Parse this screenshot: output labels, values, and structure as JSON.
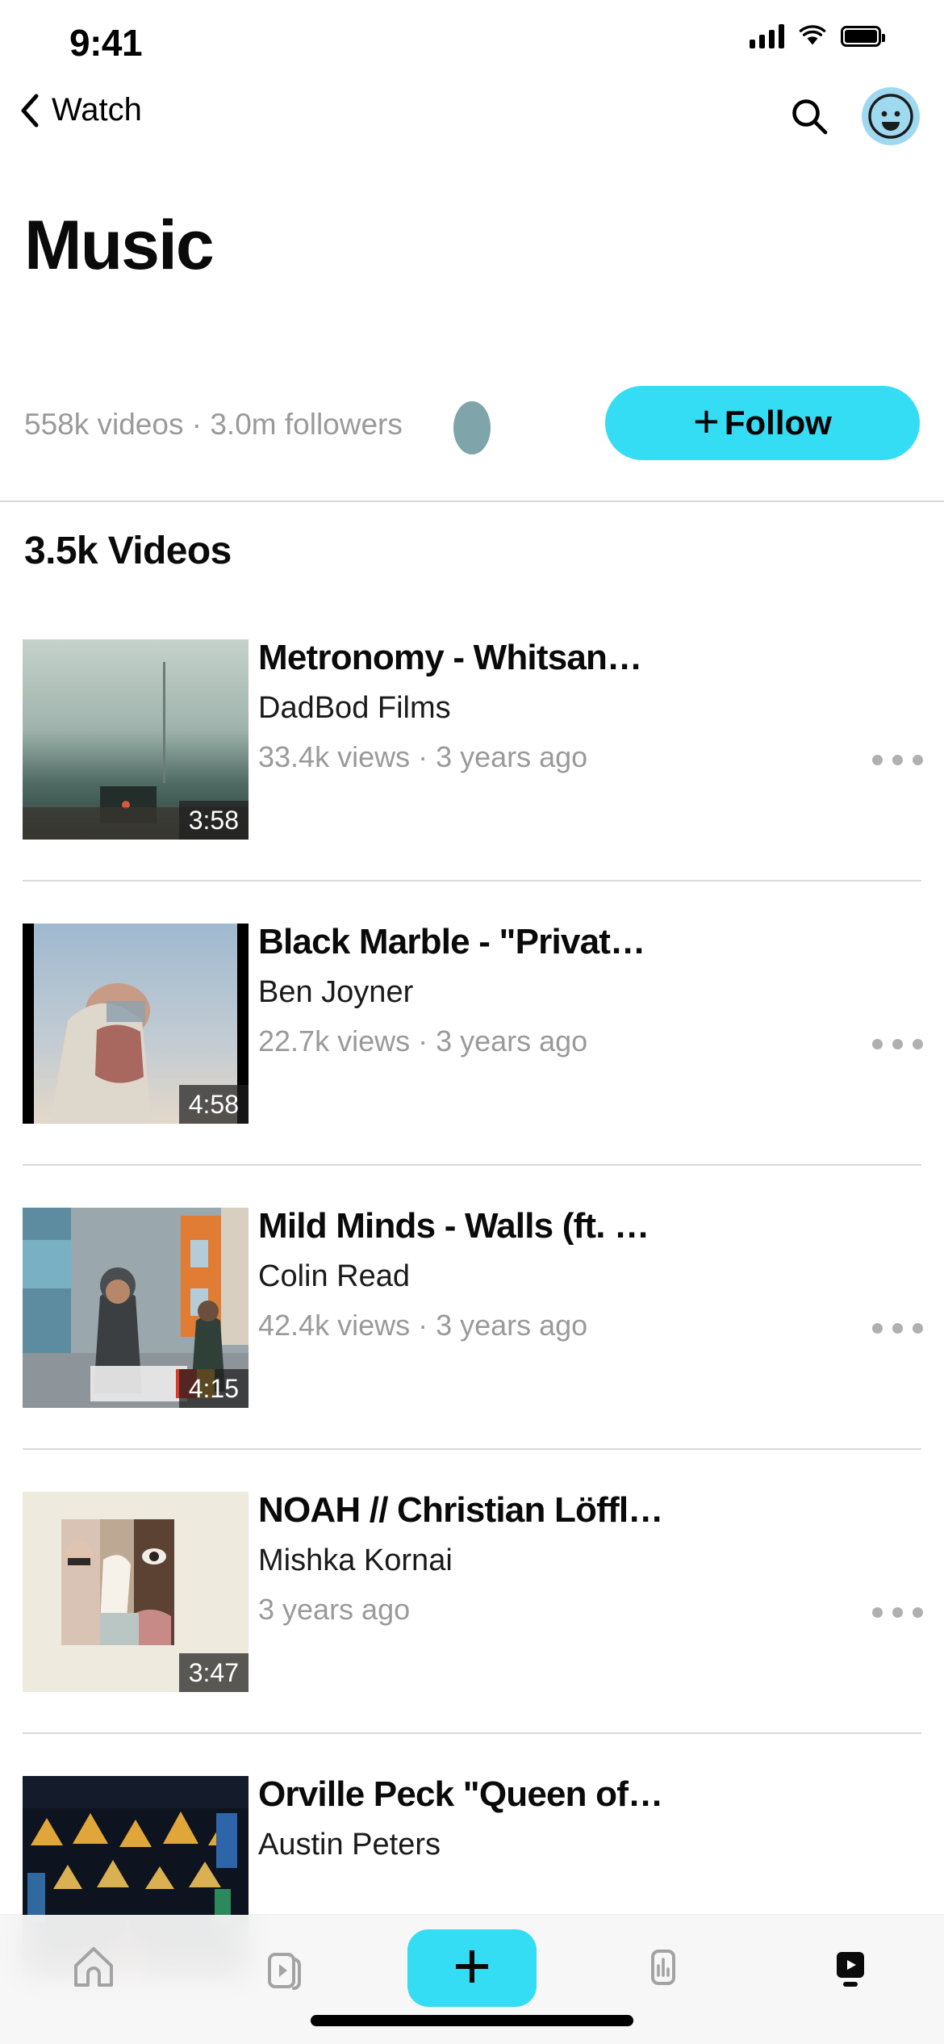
{
  "status_bar": {
    "time": "9:41",
    "cellular_icon": "signal-bars-icon",
    "wifi_icon": "wifi-icon",
    "battery_icon": "battery-full-icon"
  },
  "nav": {
    "back_icon": "chevron-left-icon",
    "back_label": "Watch",
    "search_icon": "search-icon",
    "avatar_icon": "smiley-avatar-icon"
  },
  "header": {
    "title": "Music",
    "stats": "558k videos · 3.0m followers",
    "follow_plus": "+",
    "follow_label": "Follow",
    "follow_bg_color": "#34dcf4"
  },
  "section": {
    "heading": "3.5k Videos"
  },
  "videos": [
    {
      "title": "Metronomy - Whitsan…",
      "author": "DadBod Films",
      "stats": "33.4k views · 3 years ago",
      "duration": "3:58",
      "menu_icon": "more-options-icon",
      "thumb": "foggy-field-shed"
    },
    {
      "title": "Black Marble - \"Privat…",
      "author": "Ben Joyner",
      "stats": "22.7k views · 3 years ago",
      "duration": "4:58",
      "menu_icon": "more-options-icon",
      "thumb": "man-sky-portrait"
    },
    {
      "title": "Mild Minds - Walls (ft. …",
      "author": "Colin Read",
      "stats": "42.4k views · 3 years ago",
      "duration": "4:15",
      "menu_icon": "more-options-icon",
      "thumb": "street-winter-laurels"
    },
    {
      "title": "NOAH // Christian Löffl…",
      "author": "Mishka Kornai",
      "stats": "3 years ago",
      "duration": "3:47",
      "menu_icon": "more-options-icon",
      "thumb": "collage-faces-cream"
    },
    {
      "title": "Orville Peck \"Queen of…",
      "author": "Austin Peters",
      "stats": "",
      "duration": "",
      "menu_icon": "more-options-icon",
      "thumb": "neon-bar-lamps"
    }
  ],
  "tabbar": {
    "items": [
      {
        "icon": "home-icon",
        "active": false
      },
      {
        "icon": "video-library-icon",
        "active": false
      },
      {
        "icon": "create-plus-icon",
        "active": false
      },
      {
        "icon": "stats-bars-icon",
        "active": false
      },
      {
        "icon": "watch-tv-icon",
        "active": true
      }
    ],
    "create_bg_color": "#34dcf4"
  }
}
